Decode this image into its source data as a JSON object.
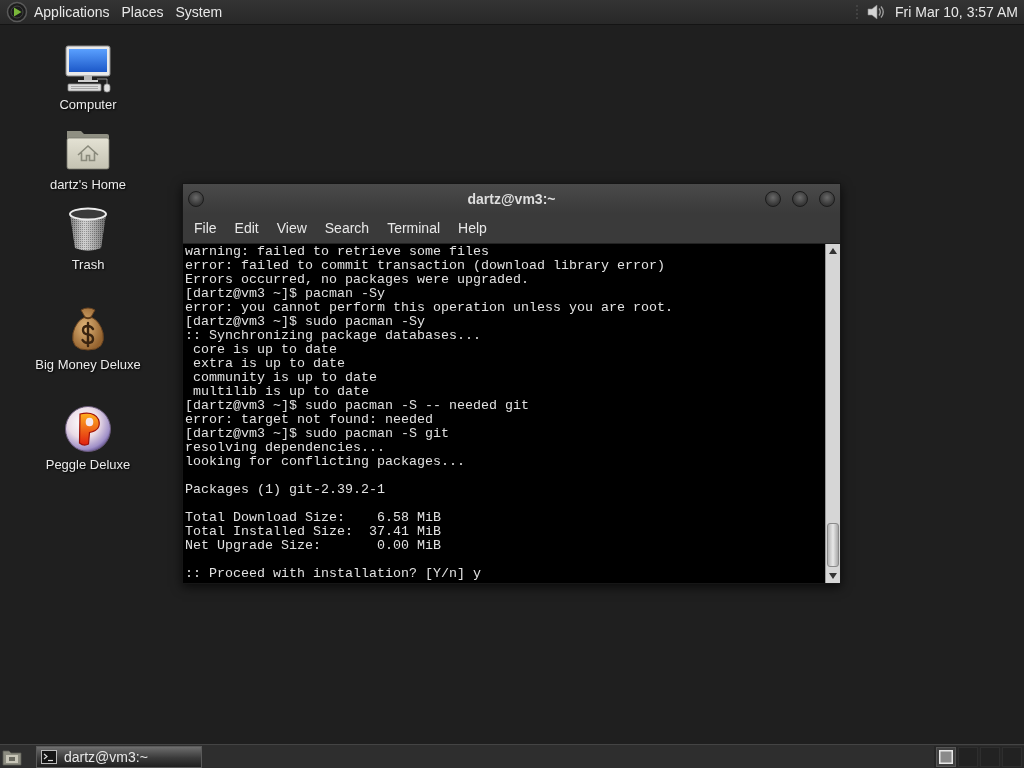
{
  "top_panel": {
    "menus": [
      "Applications",
      "Places",
      "System"
    ],
    "clock": "Fri Mar 10, 3:57 AM"
  },
  "desktop_icons": [
    {
      "label": "Computer",
      "kind": "computer"
    },
    {
      "label": "dartz's Home",
      "kind": "home"
    },
    {
      "label": "Trash",
      "kind": "trash"
    },
    {
      "label": "Big Money Deluxe",
      "kind": "money"
    },
    {
      "label": "Peggle Deluxe",
      "kind": "game"
    }
  ],
  "terminal_window": {
    "title": "dartz@vm3:~",
    "menu": [
      "File",
      "Edit",
      "View",
      "Search",
      "Terminal",
      "Help"
    ],
    "output_blocks": [
      [
        "warning: failed to retrieve some files",
        "error: failed to commit transaction (download library error)",
        "Errors occurred, no packages were upgraded.",
        "[dartz@vm3 ~]$ pacman -Sy",
        "error: you cannot perform this operation unless you are root.",
        "[dartz@vm3 ~]$ sudo pacman -Sy",
        ":: Synchronizing package databases...",
        " core is up to date",
        " extra is up to date",
        " community is up to date",
        " multilib is up to date",
        "[dartz@vm3 ~]$ sudo pacman -S -- needed git",
        "error: target not found: needed",
        "[dartz@vm3 ~]$ sudo pacman -S git",
        "resolving dependencies...",
        "looking for conflicting packages..."
      ],
      [
        "Packages (1) git-2.39.2-1"
      ],
      [
        "Total Download Size:    6.58 MiB",
        "Total Installed Size:  37.41 MiB",
        "Net Upgrade Size:       0.00 MiB"
      ],
      [
        ":: Proceed with installation? [Y/n] y"
      ]
    ]
  },
  "bottom_panel": {
    "tasks": [
      {
        "label": "dartz@vm3:~",
        "active": true
      }
    ],
    "workspaces": [
      {
        "selected": true
      },
      {
        "selected": false
      },
      {
        "selected": false
      },
      {
        "selected": false
      }
    ]
  }
}
